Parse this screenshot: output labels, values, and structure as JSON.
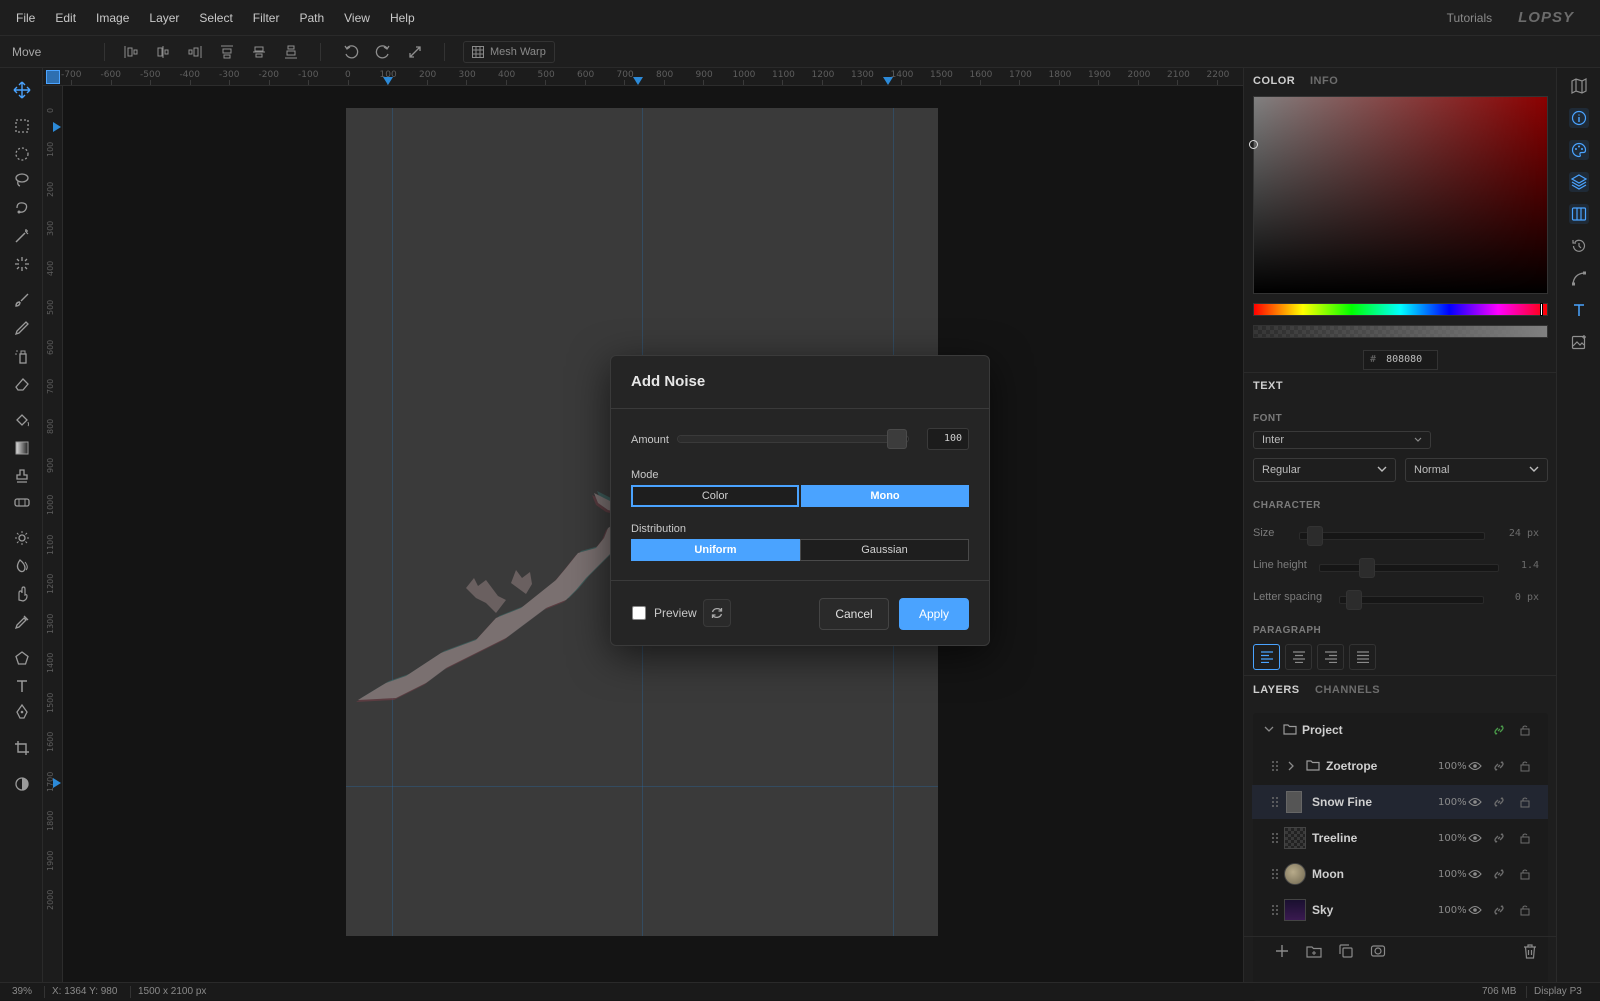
{
  "menubar": {
    "items": [
      "File",
      "Edit",
      "Image",
      "Layer",
      "Select",
      "Filter",
      "Path",
      "View",
      "Help"
    ],
    "tutorials": "Tutorials",
    "logo": "LOPSY"
  },
  "options": {
    "tool_name": "Move",
    "mesh_warp": "Mesh Warp"
  },
  "ruler": {
    "top": [
      "-700",
      "-600",
      "-500",
      "-400",
      "-300",
      "-200",
      "-100",
      "0",
      "100",
      "200",
      "300",
      "400",
      "500",
      "600",
      "700",
      "800",
      "900",
      "1000",
      "1100",
      "1200",
      "1300",
      "1400",
      "1500",
      "1600",
      "1700",
      "1800",
      "1900",
      "2000",
      "2100",
      "2200"
    ],
    "left": [
      "0",
      "100",
      "200",
      "300",
      "400",
      "500",
      "600",
      "700",
      "800",
      "900",
      "1000",
      "1100",
      "1200",
      "1300",
      "1400",
      "1500",
      "1600",
      "1700",
      "1800",
      "1900",
      "2000"
    ]
  },
  "dialog": {
    "title": "Add Noise",
    "amount_label": "Amount",
    "amount_value": "100",
    "amount_fraction": 1.0,
    "mode_label": "Mode",
    "mode_options": [
      "Color",
      "Mono"
    ],
    "mode_selected": "Mono",
    "distribution_label": "Distribution",
    "distribution_options": [
      "Uniform",
      "Gaussian"
    ],
    "distribution_selected": "Uniform",
    "preview_label": "Preview",
    "preview_checked": false,
    "cancel": "Cancel",
    "apply": "Apply"
  },
  "panel": {
    "color_tab": "COLOR",
    "info_tab": "INFO",
    "hex_prefix": "#",
    "hex_value": "808080",
    "text_header": "TEXT",
    "font_label": "FONT",
    "font_family": "Inter",
    "font_weight": "Regular",
    "font_style": "Normal",
    "character_label": "CHARACTER",
    "size_label": "Size",
    "size_value": "24 px",
    "line_height_label": "Line height",
    "line_height_value": "1.4",
    "letter_spacing_label": "Letter spacing",
    "letter_spacing_value": "0 px",
    "paragraph_label": "PARAGRAPH",
    "layers_tab": "LAYERS",
    "channels_tab": "CHANNELS"
  },
  "layers": [
    {
      "name": "Project",
      "opacity": ""
    },
    {
      "name": "Zoetrope",
      "opacity": "100%"
    },
    {
      "name": "Snow Fine",
      "opacity": "100%"
    },
    {
      "name": "Treeline",
      "opacity": "100%"
    },
    {
      "name": "Moon",
      "opacity": "100%"
    },
    {
      "name": "Sky",
      "opacity": "100%"
    }
  ],
  "status": {
    "zoom": "39%",
    "coords": "X: 1364 Y: 980",
    "doc_size": "1500 x 2100 px",
    "memory": "706 MB",
    "display": "Display P3"
  },
  "colors": {
    "accent": "#4aa3ff",
    "background": "#161616",
    "panel": "#1e1e1e"
  }
}
